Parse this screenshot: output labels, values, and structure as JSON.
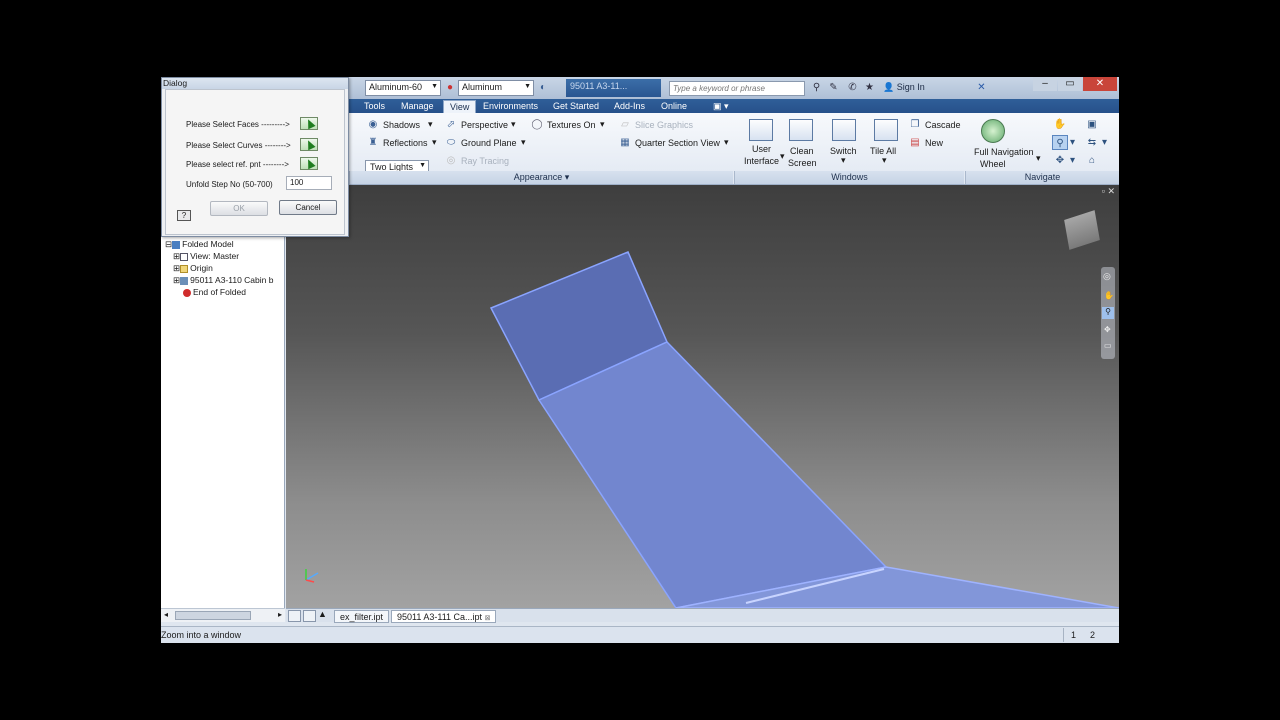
{
  "title_bar": {
    "material": "Aluminum-60",
    "appearance": "Aluminum",
    "document_name": "95011 A3-11...",
    "search_placeholder": "Type a keyword or phrase",
    "sign_in": "Sign In"
  },
  "tabs": [
    "Tools",
    "Manage",
    "View",
    "Environments",
    "Get Started",
    "Add-Ins",
    "Online"
  ],
  "active_tab": "View",
  "ribbon": {
    "appearance": {
      "shadows": "Shadows",
      "reflections": "Reflections",
      "lighting": "Two Lights",
      "perspective": "Perspective",
      "ground_plane": "Ground Plane",
      "ray_tracing": "Ray Tracing",
      "textures": "Textures On",
      "slice_graphics": "Slice Graphics",
      "quarter_section": "Quarter Section View",
      "panel_title": "Appearance"
    },
    "windows": {
      "user_interface_1": "User",
      "user_interface_2": "Interface",
      "clean_screen_1": "Clean",
      "clean_screen_2": "Screen",
      "switch": "Switch",
      "tile_all": "Tile All",
      "cascade": "Cascade",
      "new": "New",
      "panel_title": "Windows"
    },
    "navigate": {
      "full_nav_1": "Full Navigation",
      "full_nav_2": "Wheel",
      "panel_title": "Navigate"
    }
  },
  "browser": {
    "items": [
      "Folded Model",
      "View: Master",
      "Origin",
      "95011 A3-110 Cabin b",
      "End of Folded"
    ]
  },
  "doc_tabs": [
    "ex_filter.ipt",
    "95011 A3-111 Ca...ipt"
  ],
  "status": {
    "message": "Zoom into a window",
    "num1": "1",
    "num2": "2"
  },
  "dialog": {
    "title": "Dialog",
    "select_faces": "Please Select Faces --------->",
    "select_curves": "Please Select Curves -------->",
    "select_ref": "Please select ref. pnt -------->",
    "unfold_label": "Unfold Step No  (50-700)",
    "unfold_value": "100",
    "ok": "OK",
    "cancel": "Cancel",
    "help": "?"
  },
  "colors": {
    "ribbon_tab_bar": "#2f5f99",
    "model_face": "#7d8fd8",
    "viewport_top": "#3e3e3e"
  }
}
